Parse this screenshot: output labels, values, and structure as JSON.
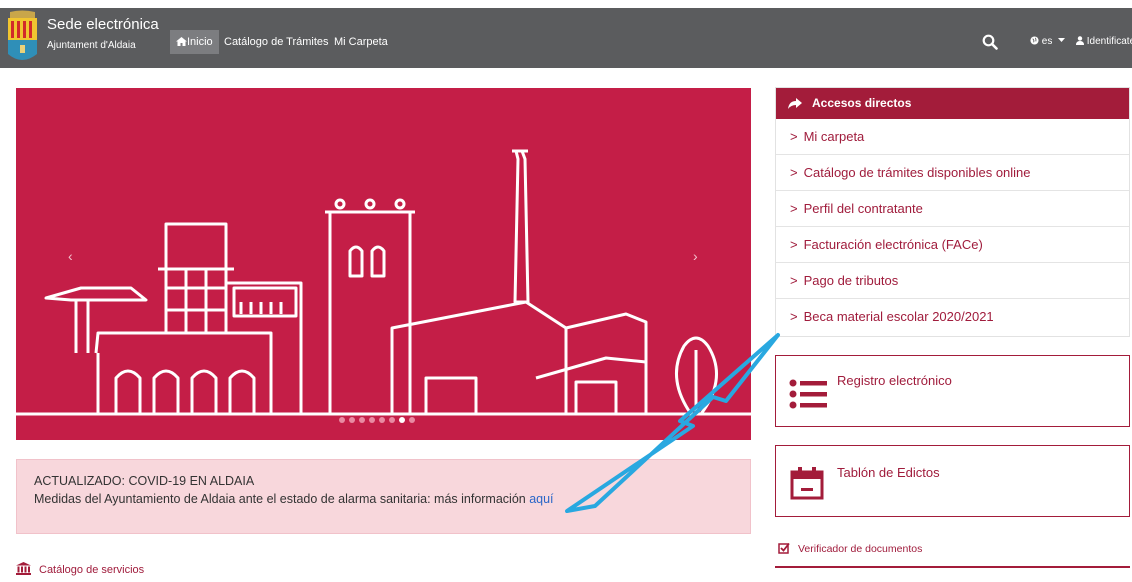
{
  "header": {
    "title": "Sede electrónica",
    "subtitle": "Ajuntament d'Aldaia",
    "nav": {
      "inicio": "Inicio",
      "catalogo": "Catálogo de Trámites",
      "carpeta": "Mi Carpeta"
    },
    "lang": "es",
    "login": "Identificate"
  },
  "carousel": {
    "prev": "‹",
    "next": "›",
    "slides": 8,
    "active_slide": 7
  },
  "alert": {
    "title": "ACTUALIZADO: COVID-19 EN ALDAIA",
    "text": "Medidas del Ayuntamiento de Aldaia ante el estado de alarma sanitaria: más información ",
    "link": "aquí"
  },
  "catalog_link": "Catálogo de servicios",
  "quick_access": {
    "title": "Accesos directos",
    "items": [
      "Mi carpeta",
      "Catálogo de trámites disponibles online",
      "Perfil del contratante",
      "Facturación electrónica (FACe)",
      "Pago de tributos",
      "Beca material escolar 2020/2021"
    ]
  },
  "cards": {
    "registro": "Registro electrónico",
    "tablon": "Tablón de Edictos"
  },
  "verificador": "Verificador de documentos",
  "colors": {
    "topbar": "#5b5c5e",
    "brand": "#a31c3a",
    "carousel": "#c41e47",
    "alert_bg": "#f8d7dc",
    "annotation_arrow": "#29a8e0"
  },
  "icons": [
    "coat-of-arms-icon",
    "home-icon",
    "search-icon",
    "globe-icon",
    "caret-down-icon",
    "user-icon",
    "share-arrow-icon",
    "chevron-right-icon",
    "list-icon",
    "calendar-icon",
    "bank-icon",
    "checkbox-icon"
  ]
}
